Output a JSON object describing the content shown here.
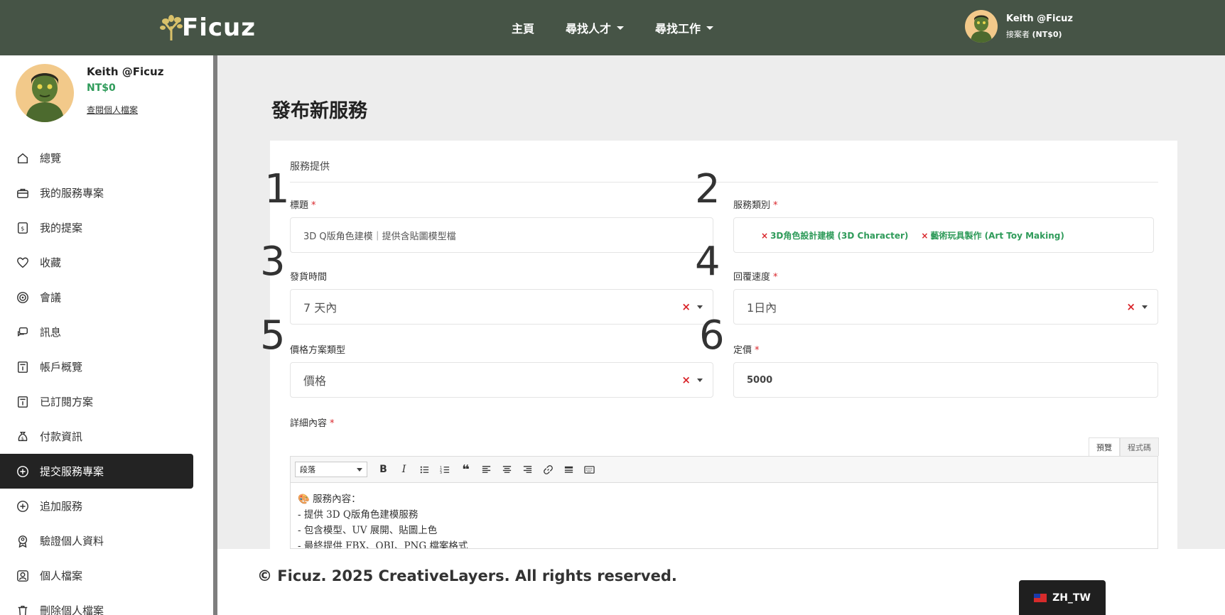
{
  "brand": {
    "name": "Ficuz"
  },
  "nav": {
    "home": "主頁",
    "find_talent": "尋找人才",
    "find_work": "尋找工作"
  },
  "top_user": {
    "name": "Keith @Ficuz",
    "role": "接案者",
    "balance": "(NT$0)"
  },
  "sidebar": {
    "name": "Keith @Ficuz",
    "balance": "NT$0",
    "profile_link": "查閱個人檔案",
    "items": [
      {
        "label": "總覽",
        "icon": "home-icon"
      },
      {
        "label": "我的服務專案",
        "icon": "briefcase-icon"
      },
      {
        "label": "我的提案",
        "icon": "proposal-icon"
      },
      {
        "label": "收藏",
        "icon": "heart-icon"
      },
      {
        "label": "會議",
        "icon": "target-icon"
      },
      {
        "label": "訊息",
        "icon": "chat-icon"
      },
      {
        "label": "帳戶概覽",
        "icon": "account-icon"
      },
      {
        "label": "已訂閱方案",
        "icon": "subscription-icon"
      },
      {
        "label": "付款資訊",
        "icon": "money-bag-icon"
      },
      {
        "label": "提交服務專案",
        "icon": "plus-circle-icon",
        "active": true
      },
      {
        "label": "追加服務",
        "icon": "plus-circle-icon"
      },
      {
        "label": "驗證個人資料",
        "icon": "badge-icon"
      },
      {
        "label": "個人檔案",
        "icon": "user-icon"
      },
      {
        "label": "刪除個人檔案",
        "icon": "trash-icon"
      }
    ]
  },
  "page": {
    "title": "發布新服務"
  },
  "form": {
    "section": "服務提供",
    "title_label": "標題",
    "title_value": "3D Q版角色建模｜提供含貼圖模型檔",
    "category_label": "服務類別",
    "categories": [
      "3D角色設計建模 (3D Character)",
      "藝術玩具製作 (Art Toy Making)"
    ],
    "delivery_label": "發貨時間",
    "delivery_value": "7 天內",
    "response_label": "回覆速度",
    "response_value": "1日內",
    "pricing_type_label": "價格方案類型",
    "pricing_type_value": "價格",
    "price_label": "定價",
    "price_value": "5000",
    "detail_label": "詳細內容",
    "required_mark": "*"
  },
  "annotations": [
    "1",
    "2",
    "3",
    "4",
    "5",
    "6"
  ],
  "editor": {
    "tab_preview": "預覽",
    "tab_code": "程式碼",
    "format_select": "段落",
    "lines": [
      "🎨 服務內容：",
      "- 提供 3D Q版角色建模服務",
      "- 包含模型、UV 展開、貼圖上色",
      "- 最終提供 FBX、OBJ、PNG 檔案格式"
    ]
  },
  "footer": {
    "copyright": "© Ficuz. 2025 CreativeLayers. All rights reserved."
  },
  "language": {
    "label": "ZH_TW"
  },
  "colors": {
    "topbar": "#465446",
    "accent_green": "#2f9b5a",
    "required_red": "#d9252a",
    "active_menu": "#232323"
  }
}
